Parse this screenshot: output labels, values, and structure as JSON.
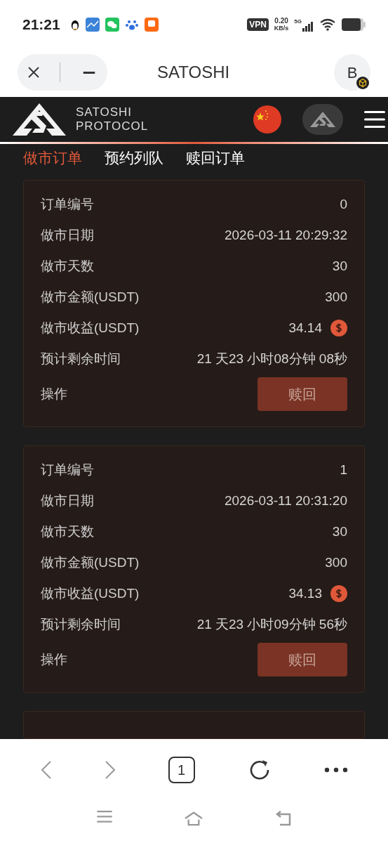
{
  "status_bar": {
    "time": "21:21",
    "vpn": "VPN",
    "speed_value": "0.20",
    "speed_unit": "KB/s",
    "network": "5G"
  },
  "browser_bar": {
    "title": "SATOSHI",
    "profile_letter": "B"
  },
  "app_header": {
    "logo_lines": [
      "SATOSHI",
      "PROTOCOL"
    ]
  },
  "tabs": [
    {
      "label": "做市订单",
      "selected": true
    },
    {
      "label": "预约列队",
      "selected": false
    },
    {
      "label": "赎回订单",
      "selected": false
    }
  ],
  "orders": [
    {
      "fields": [
        {
          "kind": "plain",
          "label": "订单编号",
          "value": "0"
        },
        {
          "kind": "plain",
          "label": "做市日期",
          "value": "2026-03-11 20:29:32"
        },
        {
          "kind": "plain",
          "label": "做市天数",
          "value": "30"
        },
        {
          "kind": "plain",
          "label": "做市金额(USDT)",
          "value": "300"
        },
        {
          "kind": "coin",
          "label": "做市收益(USDT)",
          "value": "34.14"
        },
        {
          "kind": "plain",
          "label": "预计剩余时间",
          "value": "21 天23 小时08分钟 08秒"
        },
        {
          "kind": "button",
          "label": "操作",
          "value": "赎回"
        }
      ]
    },
    {
      "fields": [
        {
          "kind": "plain",
          "label": "订单编号",
          "value": "1"
        },
        {
          "kind": "plain",
          "label": "做市日期",
          "value": "2026-03-11 20:31:20"
        },
        {
          "kind": "plain",
          "label": "做市天数",
          "value": "30"
        },
        {
          "kind": "plain",
          "label": "做市金额(USDT)",
          "value": "300"
        },
        {
          "kind": "coin",
          "label": "做市收益(USDT)",
          "value": "34.13"
        },
        {
          "kind": "plain",
          "label": "预计剩余时间",
          "value": "21 天23 小时09分钟 56秒"
        },
        {
          "kind": "button",
          "label": "操作",
          "value": "赎回"
        }
      ]
    }
  ],
  "bottom_bar": {
    "tab_count": "1"
  }
}
